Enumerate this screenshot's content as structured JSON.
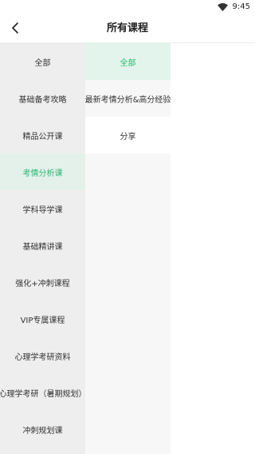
{
  "status": {
    "time": "9:45"
  },
  "header": {
    "title": "所有课程"
  },
  "categories": [
    {
      "label": "全部"
    },
    {
      "label": "基础备考攻略"
    },
    {
      "label": "精品公开课"
    },
    {
      "label": "考情分析课"
    },
    {
      "label": "学科导学课"
    },
    {
      "label": "基础精讲课"
    },
    {
      "label": "强化+冲刺课程"
    },
    {
      "label": "VIP专属课程"
    },
    {
      "label": "心理学考研资料"
    },
    {
      "label": "心理学考研（暑期规划）"
    },
    {
      "label": "冲刺规划课"
    }
  ],
  "selected_category": "考情分析课",
  "subcategories": [
    {
      "label": "全部"
    },
    {
      "label": "最新考情分析&高分经验"
    },
    {
      "label": "分享"
    }
  ],
  "selected_subcategory": "全部",
  "colors": {
    "accent": "#2bb673",
    "active_bg": "#e3f1ea",
    "col1_bg": "#eeeeee",
    "col2_bg": "#f7f7f7"
  }
}
